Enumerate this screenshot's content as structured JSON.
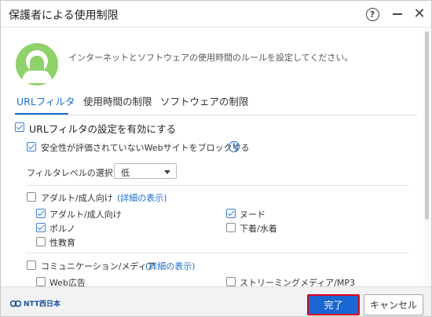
{
  "window": {
    "title": "保護者による使用制限",
    "help_glyph": "?",
    "minimize_glyph": "—",
    "close_glyph": "✕"
  },
  "intro": {
    "text": "インターネットとソフトウェアの使用時間のルールを設定してください。"
  },
  "tabs": [
    {
      "label": "URLフィルタ",
      "active": true
    },
    {
      "label": "使用時間の制限",
      "active": false
    },
    {
      "label": "ソフトウェアの制限",
      "active": false
    }
  ],
  "url_filter": {
    "enable_label": "URLフィルタの設定を有効にする",
    "enable_checked": true,
    "block_unrated_label": "安全性が評価されていないWebサイトをブロックする",
    "block_unrated_checked": true,
    "filter_level_label": "フィルタレベルの選択:",
    "filter_level_value": "低"
  },
  "categories": [
    {
      "label": "アダルト/成人向け",
      "details_link": "(詳細の表示)",
      "checked": false,
      "items": [
        {
          "label": "アダルト/成人向け",
          "checked": true
        },
        {
          "label": "ヌード",
          "checked": true
        },
        {
          "label": "ポルノ",
          "checked": true
        },
        {
          "label": "下着/水着",
          "checked": false
        },
        {
          "label": "性教育",
          "checked": false
        }
      ]
    },
    {
      "label": "コミュニケーション/メディア",
      "details_link": "(詳細の表示)",
      "checked": false,
      "items": [
        {
          "label": "Web広告",
          "checked": false
        },
        {
          "label": "ストリーミングメディア/MP3",
          "checked": false
        }
      ]
    }
  ],
  "footer": {
    "logo_text": "NTT西日本",
    "done_label": "完了",
    "cancel_label": "キャンセル"
  },
  "colors": {
    "accent": "#1a6fd0",
    "primary_button": "#1a66d2",
    "highlight_border": "#e0001b"
  }
}
